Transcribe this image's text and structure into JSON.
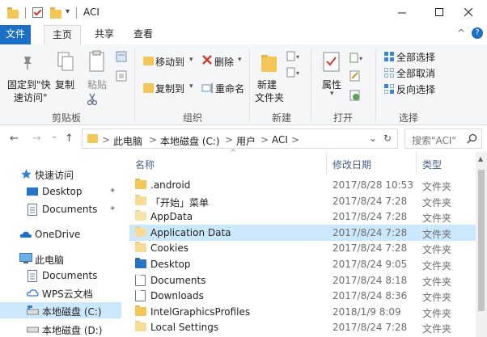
{
  "window": {
    "title": "ACI",
    "icons": [
      "folder-icon",
      "checkbox-icon",
      "folder-icon"
    ],
    "controls": {
      "minimize": "—",
      "maximize": "☐",
      "close": "✕"
    }
  },
  "tabs": {
    "file": "文件",
    "home": "主页",
    "share": "共享",
    "view": "查看",
    "expand": "^",
    "help": "?"
  },
  "ribbon": {
    "clipboard": {
      "pin_line1": "固定到\"快",
      "pin_line2": "速访问\"",
      "copy": "复制",
      "paste": "粘贴",
      "group": "剪贴板"
    },
    "organize": {
      "move_to": "移动到",
      "delete": "删除",
      "copy_to": "复制到",
      "rename": "重命名",
      "group": "组织"
    },
    "new": {
      "new_folder_line1": "新建",
      "new_folder_line2": "文件夹",
      "group": "新建"
    },
    "open": {
      "properties": "属性",
      "group": "打开"
    },
    "select": {
      "select_all": "全部选择",
      "select_none": "全部取消",
      "invert": "反向选择",
      "group": "选择"
    },
    "colors": {
      "delete_x": "#d03a2c",
      "accent": "#1a6fc7"
    }
  },
  "address": {
    "back": "←",
    "forward": "→",
    "recent": "⌄",
    "up": "↑",
    "crumbs": [
      "此电脑",
      "本地磁盘 (C:)",
      "用户",
      "ACI"
    ],
    "separator": ">",
    "dropdown": "⌄",
    "refresh": "↻",
    "search_placeholder": "搜索\"ACI\""
  },
  "nav": {
    "quick_access": "快速访问",
    "desktop": "Desktop",
    "documents": "Documents",
    "onedrive": "OneDrive",
    "this_pc": "此电脑",
    "pc_documents": "Documents",
    "wps": "WPS云文档",
    "drive_c": "本地磁盘 (C:)",
    "drive_d": "本地磁盘 (D:)"
  },
  "columns": {
    "name": "名称",
    "date": "修改日期",
    "type": "类型"
  },
  "files": [
    {
      "name": ".android",
      "date": "2017/8/28 10:53",
      "type": "文件夹",
      "icon": "folder"
    },
    {
      "name": "「开始」菜单",
      "date": "2017/8/24 7:28",
      "type": "文件夹",
      "icon": "shortcut-folder"
    },
    {
      "name": "AppData",
      "date": "2017/8/24 7:28",
      "type": "文件夹",
      "icon": "hidden-folder"
    },
    {
      "name": "Application Data",
      "date": "2017/8/24 7:28",
      "type": "文件夹",
      "icon": "shortcut-folder",
      "selected": true
    },
    {
      "name": "Cookies",
      "date": "2017/8/24 7:28",
      "type": "文件夹",
      "icon": "shortcut-folder"
    },
    {
      "name": "Desktop",
      "date": "2017/8/24 9:05",
      "type": "文件夹",
      "icon": "desktop"
    },
    {
      "name": "Documents",
      "date": "2017/8/24 8:18",
      "type": "文件夹",
      "icon": "documents"
    },
    {
      "name": "Downloads",
      "date": "2017/8/24 8:36",
      "type": "文件夹",
      "icon": "downloads"
    },
    {
      "name": "IntelGraphicsProfiles",
      "date": "2018/1/9 8:09",
      "type": "文件夹",
      "icon": "folder"
    },
    {
      "name": "Local Settings",
      "date": "2017/8/24 7:28",
      "type": "文件夹",
      "icon": "shortcut-folder"
    }
  ]
}
